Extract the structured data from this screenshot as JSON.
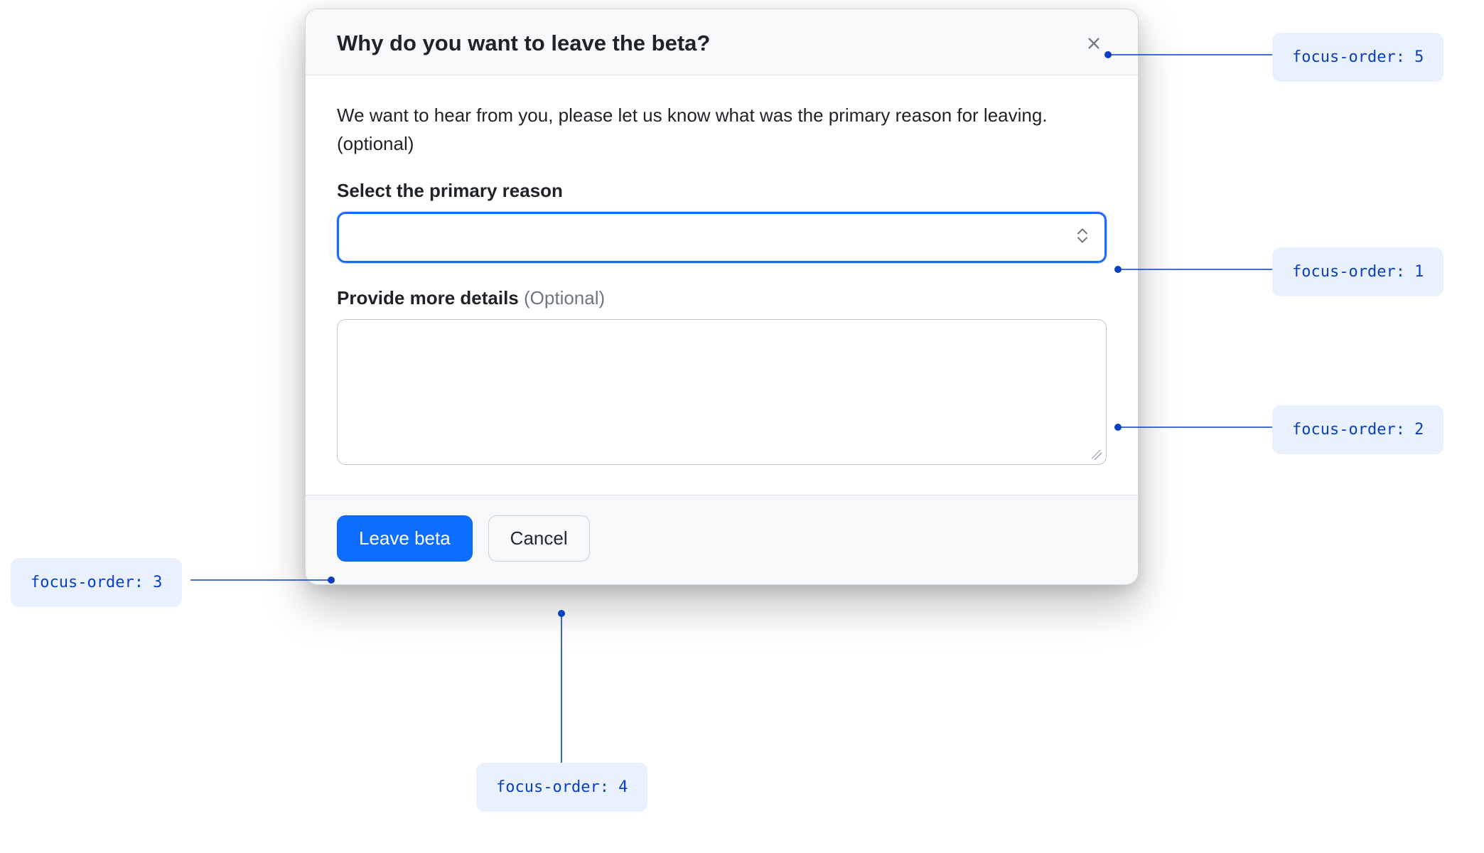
{
  "dialog": {
    "title": "Why do you want to leave the beta?",
    "intro": "We want to hear from you, please let us know what was the primary reason for leaving. (optional)",
    "primary_reason_label": "Select the primary reason",
    "details_label": "Provide more details",
    "details_optional": "(Optional)",
    "leave_label": "Leave beta",
    "cancel_label": "Cancel"
  },
  "annotations": {
    "1": "focus-order: 1",
    "2": "focus-order: 2",
    "3": "focus-order: 3",
    "4": "focus-order: 4",
    "5": "focus-order: 5"
  }
}
